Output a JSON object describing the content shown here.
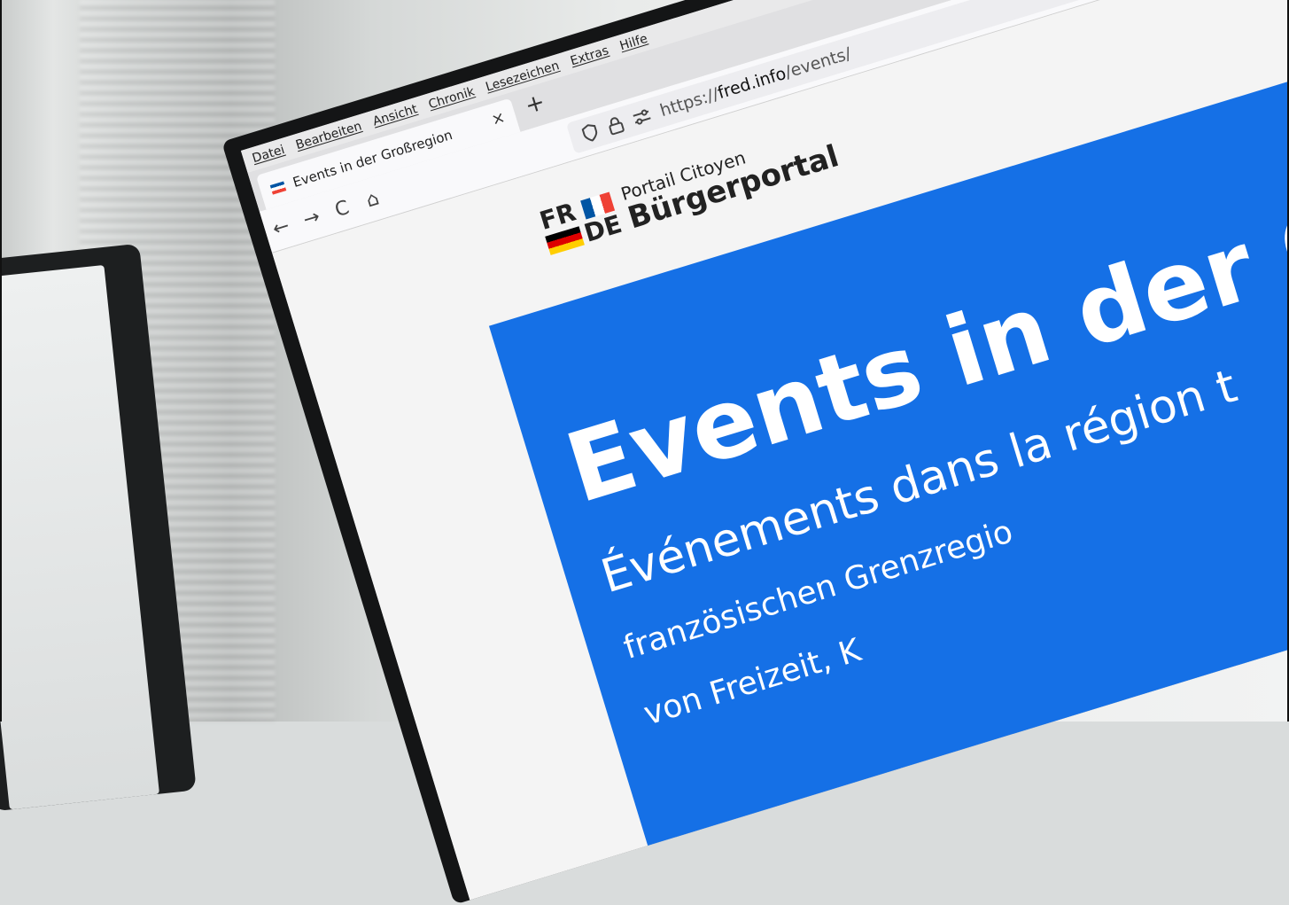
{
  "menu": [
    "Datei",
    "Bearbeiten",
    "Ansicht",
    "Chronik",
    "Lesezeichen",
    "Extras",
    "Hilfe"
  ],
  "tab": {
    "title": "Events in der Großregion",
    "close": "×",
    "new": "+"
  },
  "nav": {
    "back": "←",
    "forward": "→",
    "reload": "C",
    "home": "⌂"
  },
  "url": {
    "scheme": "https://",
    "host": "fred.info",
    "path": "/events/"
  },
  "logo": {
    "fr": "FR",
    "de": "DE",
    "subtitle": "Portail Citoyen",
    "title": "Bürgerportal"
  },
  "hero": {
    "title": "Events in der G",
    "subtitle": "Événements dans la région t",
    "line1": "französischen Grenzregio",
    "line2": "von Freizeit, K"
  },
  "colors": {
    "hero": "#1570e6",
    "bezel": "#141516"
  }
}
